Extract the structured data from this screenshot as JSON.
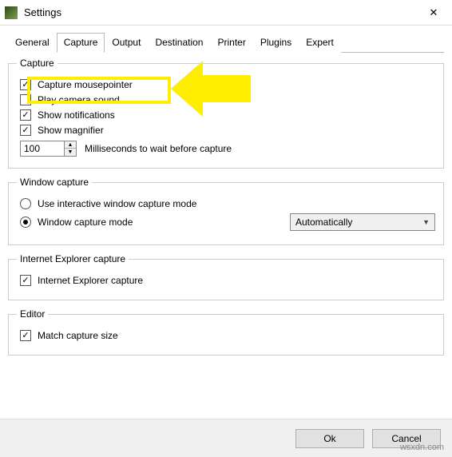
{
  "window": {
    "title": "Settings"
  },
  "tabs": [
    "General",
    "Capture",
    "Output",
    "Destination",
    "Printer",
    "Plugins",
    "Expert"
  ],
  "active_tab": 1,
  "groups": {
    "capture": {
      "legend": "Capture",
      "mousepointer": {
        "label": "Capture mousepointer",
        "checked": true
      },
      "sound": {
        "label": "Play camera sound",
        "checked": false
      },
      "notifications": {
        "label": "Show notifications",
        "checked": true
      },
      "magnifier": {
        "label": "Show magnifier",
        "checked": true
      },
      "ms_value": "100",
      "ms_label": "Milliseconds to wait before capture"
    },
    "windowcap": {
      "legend": "Window capture",
      "interactive": {
        "label": "Use interactive window capture mode",
        "checked": false
      },
      "wcm": {
        "label": "Window capture mode",
        "checked": true
      },
      "combo_value": "Automatically"
    },
    "ie": {
      "legend": "Internet Explorer capture",
      "iecap": {
        "label": "Internet Explorer capture",
        "checked": true
      }
    },
    "editor": {
      "legend": "Editor",
      "matchsize": {
        "label": "Match capture size",
        "checked": true
      }
    }
  },
  "buttons": {
    "ok": "Ok",
    "cancel": "Cancel"
  },
  "watermark": "wsxdn.com"
}
